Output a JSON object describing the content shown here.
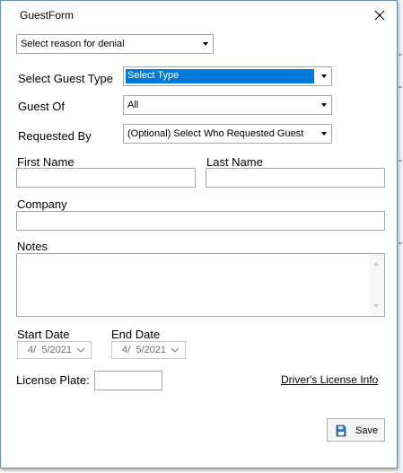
{
  "window": {
    "title": "GuestForm"
  },
  "denial_reason": {
    "value": "Select reason for denial"
  },
  "guest_type": {
    "label": "Select Guest Type",
    "value": "Select Type"
  },
  "guest_of": {
    "label": "Guest Of",
    "value": "All"
  },
  "requested_by": {
    "label": "Requested By",
    "value": "(Optional) Select Who Requested Guest"
  },
  "first_name": {
    "label": "First Name",
    "value": ""
  },
  "last_name": {
    "label": "Last Name",
    "value": ""
  },
  "company": {
    "label": "Company",
    "value": ""
  },
  "notes": {
    "label": "Notes",
    "value": ""
  },
  "start_date": {
    "label": "Start Date",
    "value": " 4/  5/2021"
  },
  "end_date": {
    "label": "End Date",
    "value": " 4/  5/2021"
  },
  "license_plate": {
    "label": "License Plate:",
    "value": ""
  },
  "drivers_license": {
    "label": "Driver's License Info"
  },
  "save": {
    "label": "Save"
  },
  "colors": {
    "selection": "#0078d7",
    "border": "#a6a6a6",
    "window_border": "#6a8fb5"
  },
  "icons": {
    "close": "close-icon",
    "save": "save-icon",
    "dropdown": "chevron-down-icon"
  }
}
